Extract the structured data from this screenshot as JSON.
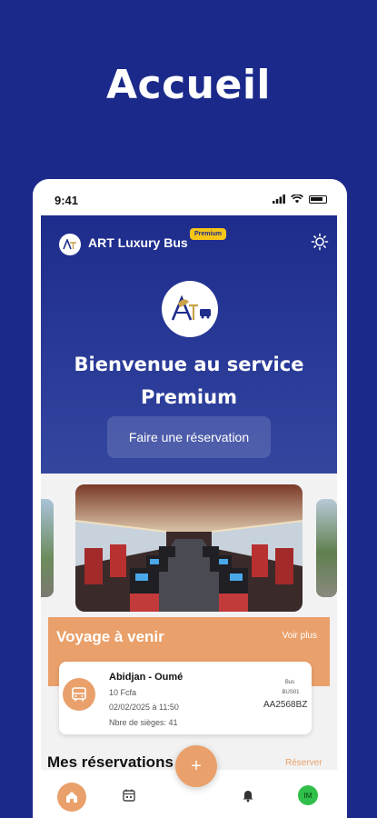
{
  "promo": {
    "title": "Accueil"
  },
  "status_bar": {
    "time": "9:41"
  },
  "header": {
    "brand_name": "ART Luxury Bus",
    "badge": "Premium"
  },
  "hero": {
    "title_line1": "Bienvenue au service",
    "title_line2": "Premium",
    "reserve_button": "Faire une réservation"
  },
  "upcoming": {
    "title": "Voyage à venir",
    "see_more": "Voir plus",
    "trip": {
      "route": "Abidjan - Oumé",
      "price": "10 Fcfa",
      "datetime": "02/02/2025 à 11:50",
      "seats": "Nbre de sièges: 41",
      "bus_label": "Bus",
      "bus_code": "BUS01",
      "plate": "AA2568BZ"
    }
  },
  "reservations": {
    "title": "Mes réservations",
    "reserve_link": "Réserver"
  },
  "fab": {
    "label": "+"
  },
  "navbar": {
    "avatar_initials": "IM"
  },
  "colors": {
    "background": "#1b2a8a",
    "accent": "#e9a06a",
    "hero": "#1e2c8c",
    "avatar": "#2fbf4a"
  }
}
